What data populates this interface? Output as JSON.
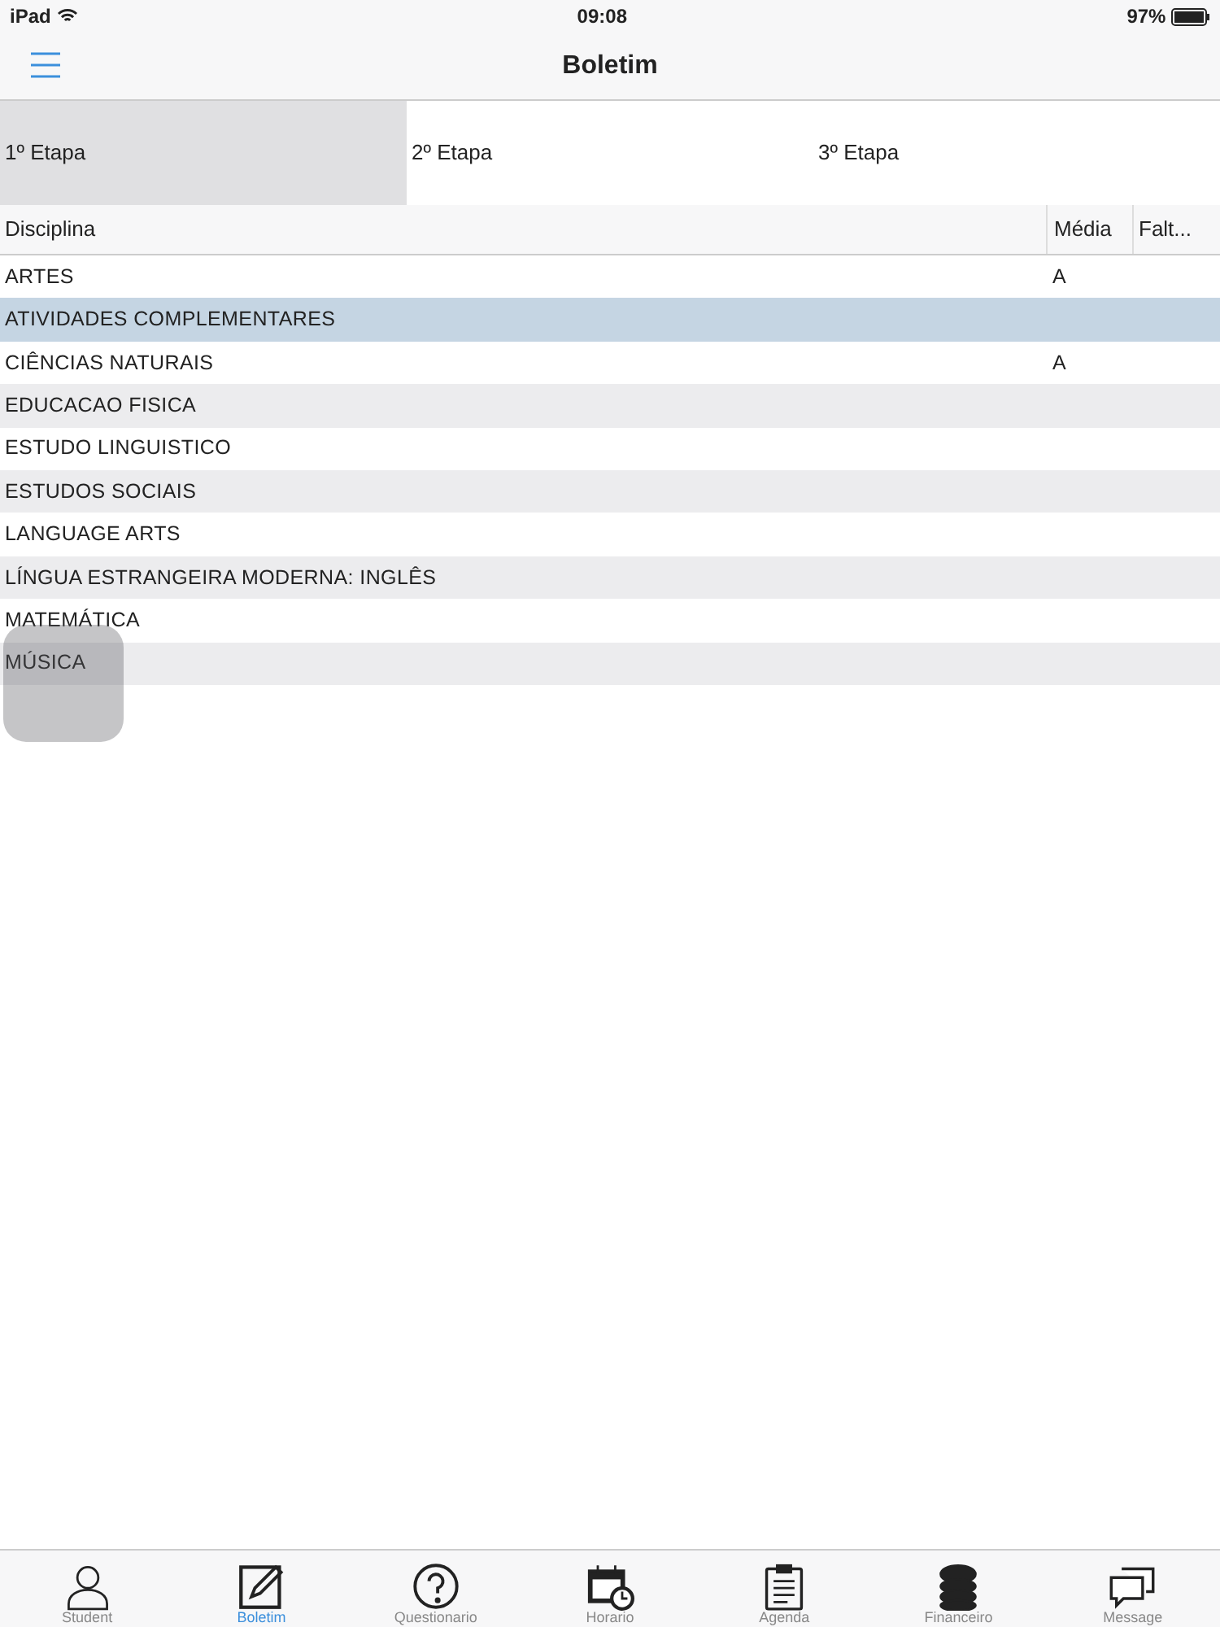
{
  "status_bar": {
    "device": "iPad",
    "time": "09:08",
    "battery": "97%"
  },
  "nav": {
    "title": "Boletim"
  },
  "tabs": [
    {
      "label": "1º Etapa",
      "selected": true
    },
    {
      "label": "2º Etapa",
      "selected": false
    },
    {
      "label": "3º Etapa",
      "selected": false
    }
  ],
  "table": {
    "columns": [
      "Disciplina",
      "Média",
      "Falt..."
    ],
    "rows": [
      {
        "disciplina": "ARTES",
        "media": "A",
        "selected": false
      },
      {
        "disciplina": "ATIVIDADES COMPLEMENTARES",
        "selected": true
      },
      {
        "disciplina": "CIÊNCIAS NATURAIS",
        "media": "A",
        "selected": false
      },
      {
        "disciplina": "EDUCACAO FISICA",
        "selected": false
      },
      {
        "disciplina": "ESTUDO LINGUISTICO",
        "selected": false
      },
      {
        "disciplina": "ESTUDOS SOCIAIS",
        "selected": false
      },
      {
        "disciplina": "LANGUAGE ARTS",
        "selected": false
      },
      {
        "disciplina": "LÍNGUA ESTRANGEIRA MODERNA: INGLÊS",
        "selected": false
      },
      {
        "disciplina": "MATEMÁTICA",
        "selected": false
      },
      {
        "disciplina": "MÚSICA",
        "selected": false
      }
    ]
  },
  "tab_bar": [
    {
      "label": "Student",
      "kind": "person",
      "selected": false
    },
    {
      "label": "Boletim",
      "kind": "edit",
      "selected": true
    },
    {
      "label": "Questionario",
      "kind": "question",
      "selected": false
    },
    {
      "label": "Horario",
      "kind": "calendar",
      "selected": false
    },
    {
      "label": "Agenda",
      "kind": "clipboard",
      "selected": false
    },
    {
      "label": "Financeiro",
      "kind": "coins",
      "selected": false
    },
    {
      "label": "Message",
      "kind": "chat",
      "selected": false
    }
  ]
}
